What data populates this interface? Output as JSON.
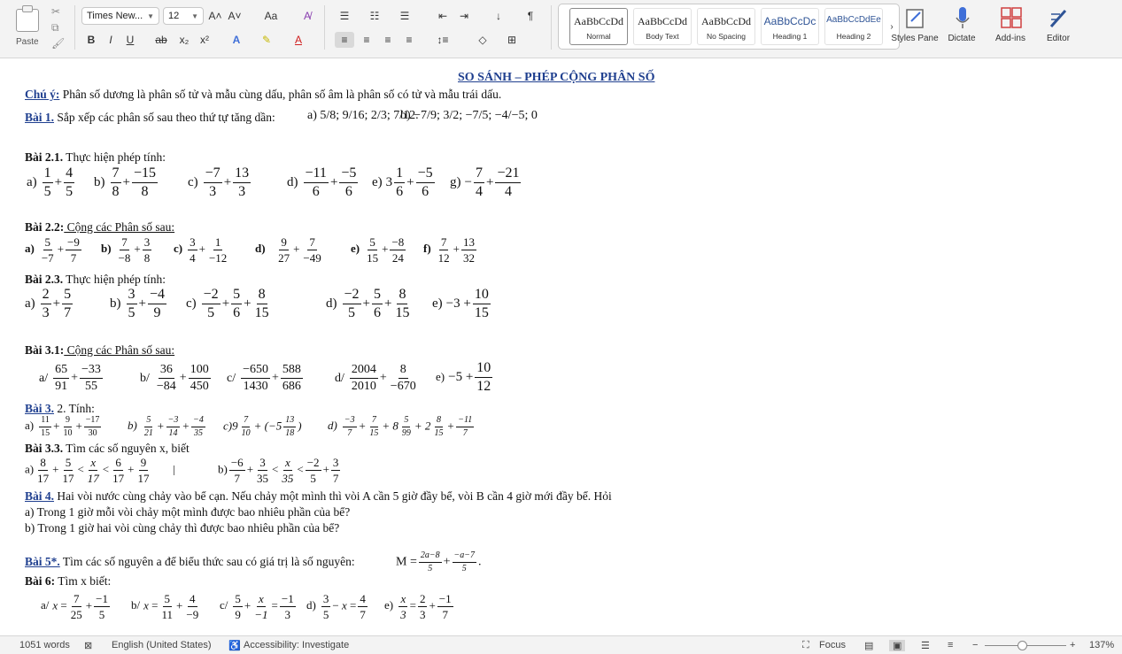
{
  "ribbon": {
    "paste_label": "Paste",
    "font_name": "Times New...",
    "font_size": "12",
    "grow_font": "A˄",
    "shrink_font": "A˅",
    "change_case": "Aa",
    "bold": "B",
    "italic": "I",
    "underline": "U",
    "strike": "ab",
    "subscript": "x₂",
    "superscript": "x²",
    "sort": "↓",
    "pilcrow": "¶",
    "styles": [
      {
        "sample": "AaBbCcDd",
        "name": "Normal"
      },
      {
        "sample": "AaBbCcDd",
        "name": "Body Text"
      },
      {
        "sample": "AaBbCcDd",
        "name": "No Spacing"
      },
      {
        "sample": "AaBbCcDc",
        "name": "Heading 1"
      },
      {
        "sample": "AaBbCcDdEe",
        "name": "Heading 2"
      }
    ],
    "styles_pane": "Styles Pane",
    "dictate": "Dictate",
    "addins": "Add-ins",
    "editor": "Editor"
  },
  "doc": {
    "title": "SO SÁNH – PHÉP CỘNG PHÂN SỐ",
    "note_label": "Chú ý:",
    "note_text": " Phân số dương là phân số tử và mẫu cùng dấu, phân số âm là phân số có tử và mẫu trái dấu.",
    "b1_label": "Bài 1.",
    "b1_text": " Sắp xếp các phân số sau theo thứ tự tăng dần:",
    "b1_a": "a) 5/8; 9/16; 2/3; 7/12.",
    "b1_b": "b) −7/9; 3/2; −7/5; −4/−5; 0",
    "b21_label": "Bài 2.1.",
    "b21_text": " Thực hiện phép tính:",
    "b21": [
      "a)",
      "b)",
      "c)",
      "d)",
      "e)",
      "g)"
    ],
    "b22_label": "Bài 2.2:",
    "b22_text": "  Cộng các Phân số sau:",
    "b22": [
      "a)",
      "b)",
      "c)",
      "d)",
      "e)",
      "f)"
    ],
    "b23_label": "Bài 2.3.",
    "b23_text": " Thực hiện phép tính:",
    "b23": [
      "a)",
      "b)",
      "c)",
      "d)",
      "e)"
    ],
    "b31_label": "Bài 3.1:",
    "b31_text": "  Cộng các Phân số sau:",
    "b31": [
      "a/",
      "b/",
      "c/",
      "d/",
      "e)"
    ],
    "b3_label": "Bài 3.",
    "b3_text": " 2. Tính:",
    "b3": [
      "a)",
      "b)",
      "c)9",
      "d)"
    ],
    "b33_label": "Bài 3.3.",
    "b33_text": " Tìm các số nguyên x, biết",
    "b33": [
      "a)",
      "b)"
    ],
    "b4_label": "Bài 4.",
    "b4_text": " Hai vòi nước cùng chảy vào bể cạn. Nếu chảy một mình thì vòi A cần 5 giờ đầy bể, vòi B cần 4 giờ mới đầy bể. Hỏi",
    "b4_a": "a) Trong 1 giờ mỗi vòi chảy một mình được bao nhiêu phần của bể?",
    "b4_b": "b) Trong 1 giờ hai vòi cùng chảy thì được bao nhiêu phần của bể?",
    "b5_label": "Bài 5*.",
    "b5_text": " Tìm các số nguyên a để biểu thức sau có giá trị là số nguyên:",
    "b5_expr": "M =",
    "b6_label": "Bài 6:",
    "b6_text": " Tìm x biết:",
    "b6": [
      "a/",
      "b/",
      "c/",
      "d)",
      "e)"
    ]
  },
  "status": {
    "words": "1051 words",
    "language": "English (United States)",
    "accessibility": "Accessibility: Investigate",
    "focus": "Focus",
    "zoom": "137%",
    "zoom_level": 0.46
  }
}
